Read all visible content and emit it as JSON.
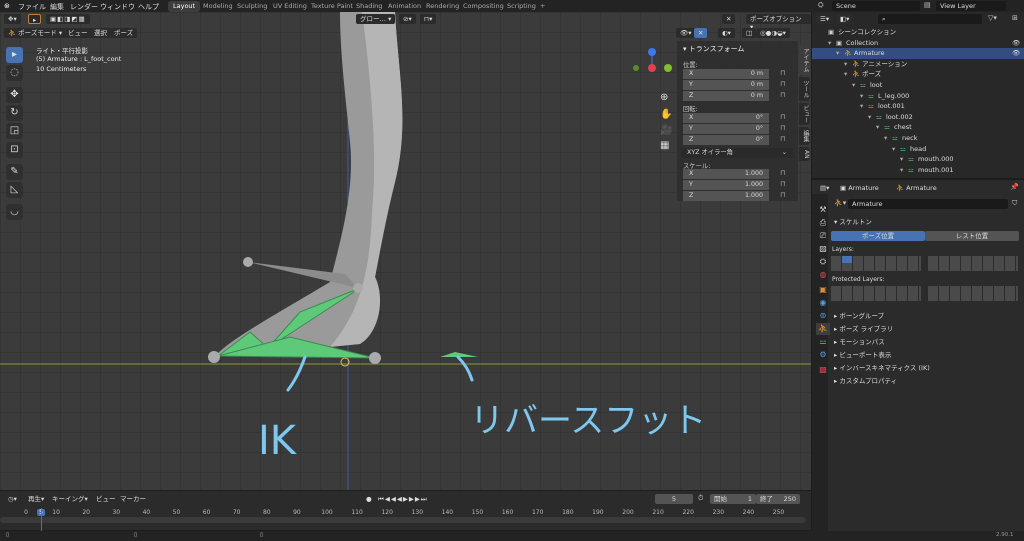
{
  "topbar": {
    "menus": [
      "ファイル",
      "編集",
      "レンダー",
      "ウィンドウ",
      "ヘルプ"
    ],
    "workspaces": [
      "Layout",
      "Modeling",
      "Sculpting",
      "UV Editing",
      "Texture Paint",
      "Shading",
      "Animation",
      "Rendering",
      "Compositing",
      "Scripting",
      "+"
    ],
    "active_workspace": "Layout",
    "scene": "Scene",
    "view_layer": "View Layer"
  },
  "viewport": {
    "mode": "ポーズモード",
    "menus": [
      "ビュー",
      "選択",
      "ポーズ"
    ],
    "orientation": "グロー…",
    "pose_options": "ポーズオプション",
    "info": {
      "view": "ライト・平行投影",
      "object": "(5) Armature : L_foot_cont",
      "scale": "10 Centimeters"
    },
    "annotations": {
      "ik": "IK",
      "reverse_foot": "リバースフット"
    },
    "tools": [
      "select-box",
      "cursor",
      "move",
      "rotate",
      "scale",
      "transform",
      "annotate",
      "measure",
      "relax"
    ]
  },
  "npanel": {
    "title": "トランスフォーム",
    "location_label": "位置:",
    "location": [
      {
        "axis": "X",
        "value": "0 m"
      },
      {
        "axis": "Y",
        "value": "0 m"
      },
      {
        "axis": "Z",
        "value": "0 m"
      }
    ],
    "rotation_label": "回転:",
    "rotation": [
      {
        "axis": "X",
        "value": "0°"
      },
      {
        "axis": "Y",
        "value": "0°"
      },
      {
        "axis": "Z",
        "value": "0°"
      }
    ],
    "rotation_mode": "XYZ オイラー角",
    "scale_label": "スケール:",
    "scale": [
      {
        "axis": "X",
        "value": "1.000"
      },
      {
        "axis": "Y",
        "value": "1.000"
      },
      {
        "axis": "Z",
        "value": "1.000"
      }
    ],
    "tabs": [
      "アイテム",
      "ツール",
      "ビュー",
      "編集",
      "AN"
    ]
  },
  "outliner": {
    "rows": [
      {
        "label": "シーンコレクション",
        "depth": 0
      },
      {
        "label": "Collection",
        "depth": 1
      },
      {
        "label": "Armature",
        "depth": 2,
        "selected": true
      },
      {
        "label": "アニメーション",
        "depth": 3
      },
      {
        "label": "ポーズ",
        "depth": 3
      },
      {
        "label": "loot",
        "depth": 4
      },
      {
        "label": "L_leg.000",
        "depth": 5
      },
      {
        "label": "loot.001",
        "depth": 5
      },
      {
        "label": "loot.002",
        "depth": 6
      },
      {
        "label": "chest",
        "depth": 7
      },
      {
        "label": "neck",
        "depth": 8
      },
      {
        "label": "head",
        "depth": 9
      },
      {
        "label": "mouth.000",
        "depth": 10
      },
      {
        "label": "mouth.001",
        "depth": 10
      }
    ]
  },
  "properties": {
    "object": "Armature",
    "data": "Armature",
    "data_field": "Armature",
    "section": "スケルトン",
    "pose_position": "ポーズ位置",
    "rest_position": "レスト位置",
    "layers_label": "Layers:",
    "protected_label": "Protected Layers:",
    "subsections": [
      "ボーングループ",
      "ポーズ ライブラリ",
      "モーションパス",
      "ビューポート表示",
      "インバースキネマティクス (IK)",
      "カスタムプロパティ"
    ]
  },
  "timeline": {
    "menus": [
      "再生",
      "キーイング",
      "ビュー",
      "マーカー"
    ],
    "current_frame": "5",
    "start_label": "開始",
    "start": "1",
    "end_label": "終了",
    "end": "250",
    "ticks": [
      "0",
      "5",
      "10",
      "20",
      "30",
      "40",
      "50",
      "60",
      "70",
      "80",
      "90",
      "100",
      "110",
      "120",
      "130",
      "140",
      "150",
      "160",
      "170",
      "180",
      "190",
      "200",
      "210",
      "220",
      "230",
      "240",
      "250"
    ]
  },
  "status": {
    "version": "2.90.1"
  },
  "colors": {
    "accent": "#4772b3",
    "bone": "#5fc97a",
    "annotation": "#7ec8f0"
  }
}
